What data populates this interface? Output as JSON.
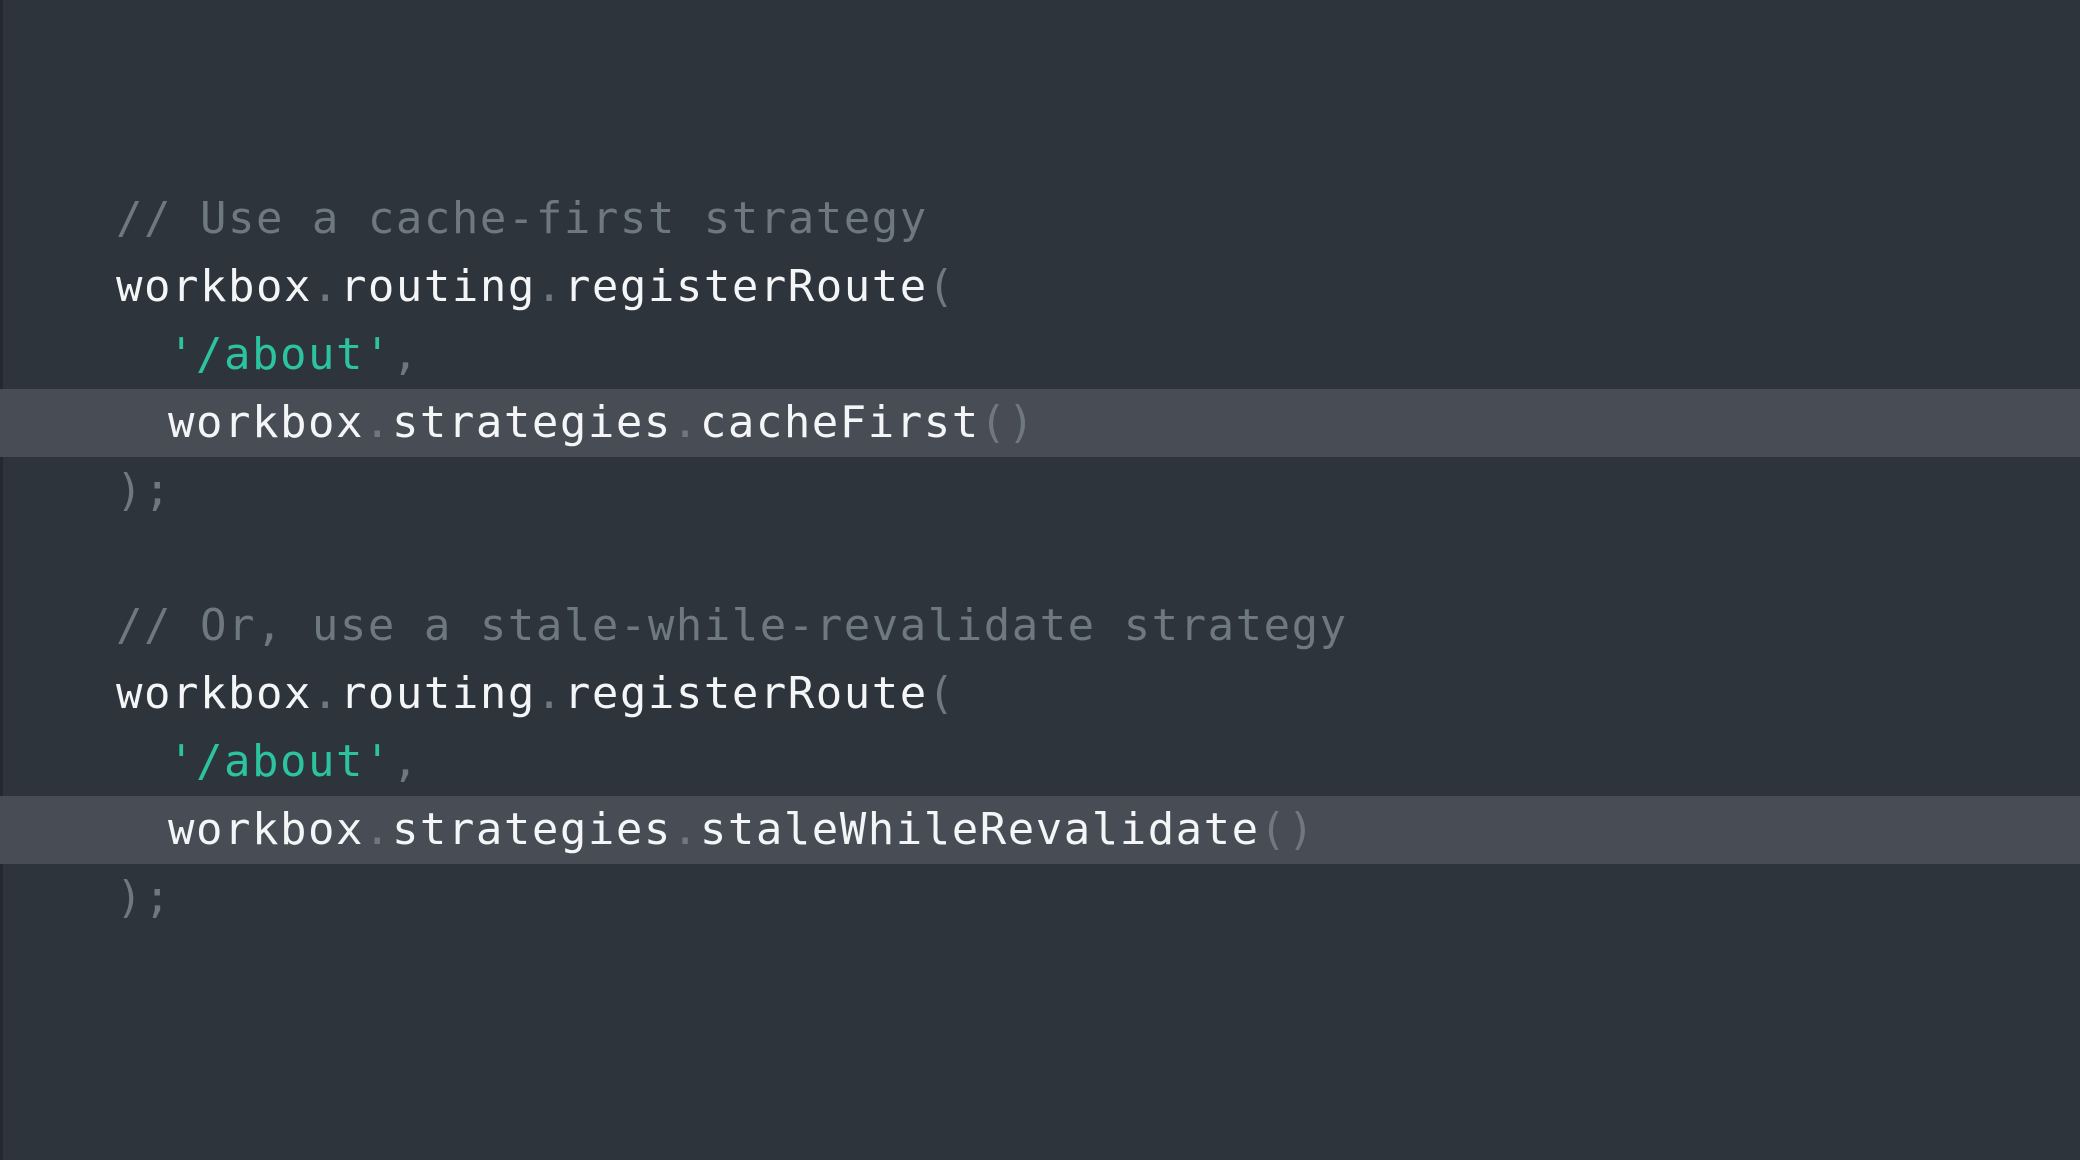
{
  "blocks": [
    {
      "comment": "// Use a cache-first strategy",
      "call": {
        "obj": "workbox",
        "dot1": ".",
        "ns": "routing",
        "dot2": ".",
        "fn": "registerRoute",
        "open": "("
      },
      "arg1": {
        "q1": "'",
        "path": "/about",
        "q2": "'",
        "comma": ","
      },
      "arg2": {
        "obj": "workbox",
        "dot1": ".",
        "ns": "strategies",
        "dot2": ".",
        "fn": "cacheFirst",
        "parens": "()"
      },
      "close": ");"
    },
    {
      "comment": "// Or, use a stale-while-revalidate strategy",
      "call": {
        "obj": "workbox",
        "dot1": ".",
        "ns": "routing",
        "dot2": ".",
        "fn": "registerRoute",
        "open": "("
      },
      "arg1": {
        "q1": "'",
        "path": "/about",
        "q2": "'",
        "comma": ","
      },
      "arg2": {
        "obj": "workbox",
        "dot1": ".",
        "ns": "strategies",
        "dot2": ".",
        "fn": "staleWhileRevalidate",
        "parens": "()"
      },
      "close": ");"
    }
  ],
  "colors": {
    "background": "#2e343b",
    "highlight": "#474c55",
    "comment": "#6e7881",
    "string": "#2bc3a0",
    "identifier": "#f4f5f6",
    "punctuation": "#6f7881"
  }
}
